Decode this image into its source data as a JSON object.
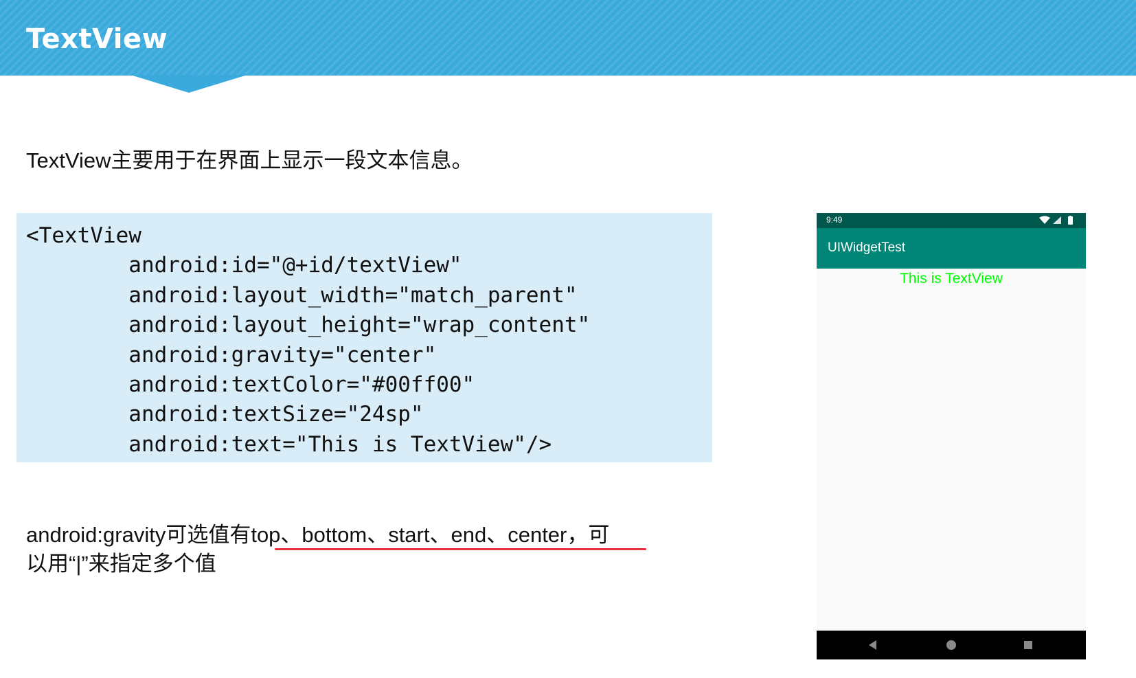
{
  "slide": {
    "title": "TextView",
    "intro": "TextView主要用于在界面上显示一段文本信息。",
    "code_lines": [
      "<TextView",
      "        android:id=\"@+id/textView\"",
      "        android:layout_width=\"match_parent\"",
      "        android:layout_height=\"wrap_content\"",
      "        android:gravity=\"center\"",
      "        android:textColor=\"#00ff00\"",
      "        android:textSize=\"24sp\"",
      "        android:text=\"This is TextView\"/>"
    ],
    "note_line1": "android:gravity可选值有top、bottom、start、end、center，可",
    "note_line2": "以用“|”来指定多个值"
  },
  "phone": {
    "status_time": "9:49",
    "app_title": "UIWidgetTest",
    "textview_text": "This is TextView",
    "textview_color": "#00ff00",
    "nav_icons": [
      "back-icon",
      "home-icon",
      "recents-icon"
    ]
  },
  "colors": {
    "banner": "#3aa9dc",
    "code_background": "#d9edf8",
    "underline": "#e8303a",
    "status_bar": "#00574b",
    "app_bar": "#008577"
  }
}
